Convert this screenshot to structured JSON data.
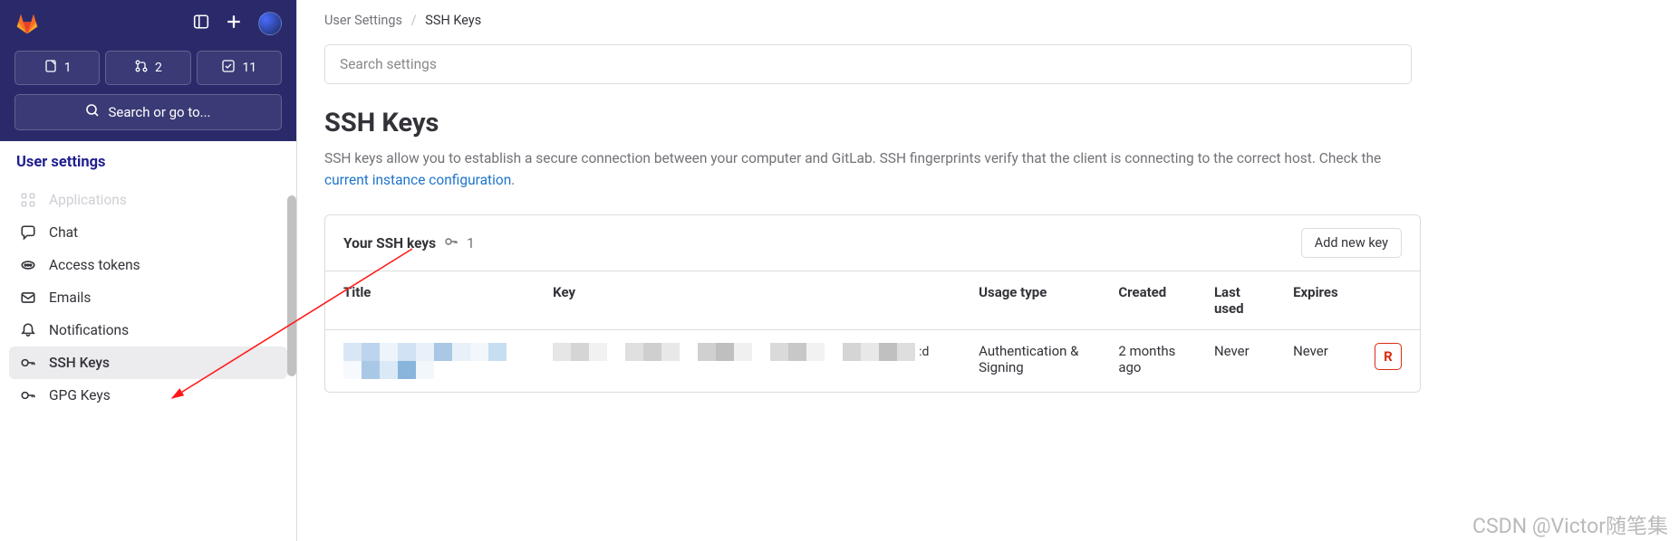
{
  "sidebar": {
    "badges": {
      "issues_count": "1",
      "mr_count": "2",
      "todo_count": "11"
    },
    "search_label": "Search or go to...",
    "section_title": "User settings",
    "items": [
      {
        "label": "Applications"
      },
      {
        "label": "Chat"
      },
      {
        "label": "Access tokens"
      },
      {
        "label": "Emails"
      },
      {
        "label": "Notifications"
      },
      {
        "label": "SSH Keys"
      },
      {
        "label": "GPG Keys"
      }
    ]
  },
  "breadcrumb": {
    "parent": "User Settings",
    "current": "SSH Keys"
  },
  "search": {
    "placeholder": "Search settings"
  },
  "page": {
    "title": "SSH Keys",
    "desc_pre": "SSH keys allow you to establish a secure connection between your computer and GitLab. SSH fingerprints verify that the client is connecting to the correct host. Check the ",
    "desc_link": "current instance configuration",
    "desc_post": "."
  },
  "card": {
    "title": "Your SSH keys",
    "count": "1",
    "add_button": "Add new key",
    "columns": {
      "title": "Title",
      "key": "Key",
      "usage": "Usage type",
      "created": "Created",
      "last_used": "Last used",
      "expires": "Expires"
    },
    "row": {
      "key_trail": ":d",
      "usage": "Authentication & Signing",
      "created": "2 months ago",
      "last_used": "Never",
      "expires": "Never",
      "delete_label": "R"
    }
  },
  "watermark": "CSDN @Victor随笔集"
}
